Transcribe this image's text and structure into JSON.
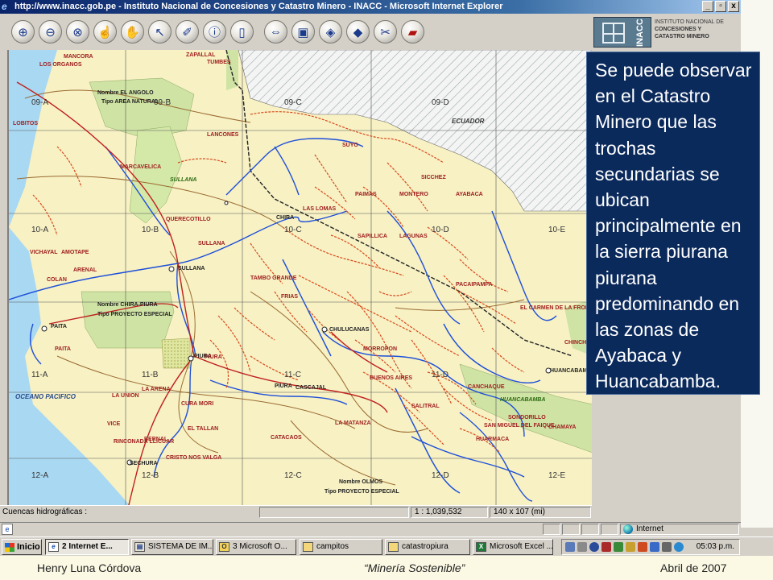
{
  "window": {
    "title": "http://www.inacc.gob.pe - Instituto Nacional de Concesiones y Catastro Minero - INACC - Microsoft Internet Explorer",
    "min": "_",
    "max": "▫",
    "close": "x"
  },
  "toolbar": {
    "tools": [
      {
        "name": "zoom-in-icon",
        "glyph": "⊕"
      },
      {
        "name": "zoom-out-icon",
        "glyph": "⊖"
      },
      {
        "name": "zoom-box-icon",
        "glyph": "⊗"
      },
      {
        "name": "hand-identify-icon",
        "glyph": "☝"
      },
      {
        "name": "pan-icon",
        "glyph": "✋"
      },
      {
        "name": "select-arrow-icon",
        "glyph": "↖"
      },
      {
        "name": "erase-icon",
        "glyph": "✐"
      },
      {
        "name": "info-icon",
        "glyph": "ⓘ"
      },
      {
        "name": "page-icon",
        "glyph": "▯"
      },
      {
        "name": "full-extent-icon",
        "glyph": "⇔"
      },
      {
        "name": "save-icon",
        "glyph": "▣"
      },
      {
        "name": "layers-icon",
        "glyph": "◈"
      },
      {
        "name": "layers-gray-icon",
        "glyph": "◆"
      },
      {
        "name": "tools-icon",
        "glyph": "✂"
      },
      {
        "name": "book-icon",
        "glyph": "▰"
      }
    ]
  },
  "logo": {
    "word": "INACC",
    "line1": "INSTITUTO NACIONAL DE",
    "line2": "CONCESIONES Y",
    "line3": "CATASTRO MINERO"
  },
  "map": {
    "grid_labels": [
      "09-A",
      "09-B",
      "09-C",
      "09-D",
      "10-A",
      "10-B",
      "10-C",
      "10-D",
      "10-E",
      "11-A",
      "11-B",
      "11-C",
      "11-D",
      "12-A",
      "12-B",
      "12-C",
      "12-D",
      "12-E"
    ],
    "places": [
      {
        "t": "MANCORA",
        "c": "red"
      },
      {
        "t": "LOS ORGANOS",
        "c": "red"
      },
      {
        "t": "TUMBES",
        "c": "red"
      },
      {
        "t": "ZAPALLAL",
        "c": "red"
      },
      {
        "t": "Nombre   EL ANGOLO",
        "c": "blk"
      },
      {
        "t": "Tipo   AREA NATURAL",
        "c": "blk"
      },
      {
        "t": "LOBITOS",
        "c": "red"
      },
      {
        "t": "LANCONES",
        "c": "red"
      },
      {
        "t": "ECUADOR",
        "c": "country"
      },
      {
        "t": "SUYO",
        "c": "red"
      },
      {
        "t": "SICCHEZ",
        "c": "red"
      },
      {
        "t": "MARCAVELICA",
        "c": "red"
      },
      {
        "t": "SULLANA",
        "c": "grn"
      },
      {
        "t": "PAIMAS",
        "c": "red"
      },
      {
        "t": "MONTERO",
        "c": "red"
      },
      {
        "t": "AYABACA",
        "c": "red"
      },
      {
        "t": "QUERECOTILLO",
        "c": "red"
      },
      {
        "t": "CHIRA",
        "c": "blk"
      },
      {
        "t": "LAS LOMAS",
        "c": "red"
      },
      {
        "t": "SULLANA",
        "c": "red"
      },
      {
        "t": "SAPILLICA",
        "c": "red"
      },
      {
        "t": "LAGUNAS",
        "c": "red"
      },
      {
        "t": "VICHAYAL",
        "c": "red"
      },
      {
        "t": "AMOTAPE",
        "c": "red"
      },
      {
        "t": "ARENAL",
        "c": "red"
      },
      {
        "t": "COLAN",
        "c": "red"
      },
      {
        "t": "SULLANA",
        "c": "blk"
      },
      {
        "t": "TAMBO GRANDE",
        "c": "red"
      },
      {
        "t": "FRIAS",
        "c": "red"
      },
      {
        "t": "PACAIPAMPA",
        "c": "red"
      },
      {
        "t": "Nombre   CHIRA-PIURA",
        "c": "blk"
      },
      {
        "t": "Tipo   PROYECTO ESPECIAL",
        "c": "blk"
      },
      {
        "t": "PAITA",
        "c": "blk"
      },
      {
        "t": "PAITA",
        "c": "red"
      },
      {
        "t": "EL CARMEN DE LA FRONTERA",
        "c": "red"
      },
      {
        "t": "CHULUCANAS",
        "c": "blk"
      },
      {
        "t": "CHINCHIPE",
        "c": "red"
      },
      {
        "t": "PIURA",
        "c": "blk"
      },
      {
        "t": "MORROPON",
        "c": "red"
      },
      {
        "t": "BUENOS AIRES",
        "c": "red"
      },
      {
        "t": "HUANCABAMBA",
        "c": "blk"
      },
      {
        "t": "OCEANO PACIFICO",
        "c": "ocean"
      },
      {
        "t": "LA ARENA",
        "c": "red"
      },
      {
        "t": "PIURA",
        "c": "red"
      },
      {
        "t": "PIURA",
        "c": "blk"
      },
      {
        "t": "CASCAJAL",
        "c": "blk"
      },
      {
        "t": "CANCHAQUE",
        "c": "red"
      },
      {
        "t": "HUANCABAMBA",
        "c": "grn"
      },
      {
        "t": "LA UNION",
        "c": "red"
      },
      {
        "t": "CURA MORI",
        "c": "red"
      },
      {
        "t": "SONDORILLO",
        "c": "red"
      },
      {
        "t": "SALITRAL",
        "c": "red"
      },
      {
        "t": "EL TALLAN",
        "c": "red"
      },
      {
        "t": "LA MATANZA",
        "c": "red"
      },
      {
        "t": "SAN MIGUEL DEL FAIQUE",
        "c": "red"
      },
      {
        "t": "HUARMACA",
        "c": "red"
      },
      {
        "t": "CHAMAYA",
        "c": "red"
      },
      {
        "t": "VICE",
        "c": "red"
      },
      {
        "t": "CATACAOS",
        "c": "red"
      },
      {
        "t": "RINCONADA LLICUAR",
        "c": "red"
      },
      {
        "t": "BERNAL",
        "c": "red"
      },
      {
        "t": "CRISTO NOS VALGA",
        "c": "red"
      },
      {
        "t": "SECHURA",
        "c": "blk"
      },
      {
        "t": "Nombre   OLMOS",
        "c": "blk"
      },
      {
        "t": "Tipo   PROYECTO ESPECIAL",
        "c": "blk"
      }
    ]
  },
  "overlay": {
    "text": "Se puede observar en el Catastro Minero que las trochas secundarias  se ubican principalmente en la sierra piurana  piurana predominando en las zonas de Ayabaca y Huancabamba."
  },
  "status": {
    "left": "Cuencas hidrográficas :",
    "scale": "1 : 1,039,532",
    "size": "140 x 107 (mi)"
  },
  "iestatus": {
    "zone": "Internet"
  },
  "taskbar": {
    "start": "Inicio",
    "tasks": [
      {
        "label": "2 Internet E...",
        "icon": "ie",
        "active": true
      },
      {
        "label": "SISTEMA DE IM...",
        "icon": "wd",
        "active": false
      },
      {
        "label": "3 Microsoft O...",
        "icon": "ol",
        "active": false
      },
      {
        "label": "campitos",
        "icon": "fd",
        "active": false
      },
      {
        "label": "catastropiura",
        "icon": "fd",
        "active": false
      },
      {
        "label": "Microsoft Excel ...",
        "icon": "xl",
        "active": false
      }
    ],
    "clock": "05:03 p.m."
  },
  "footer": {
    "author": "Henry Luna Córdova",
    "theme": "“Minería Sostenible”",
    "date": "Abril de 2007"
  }
}
